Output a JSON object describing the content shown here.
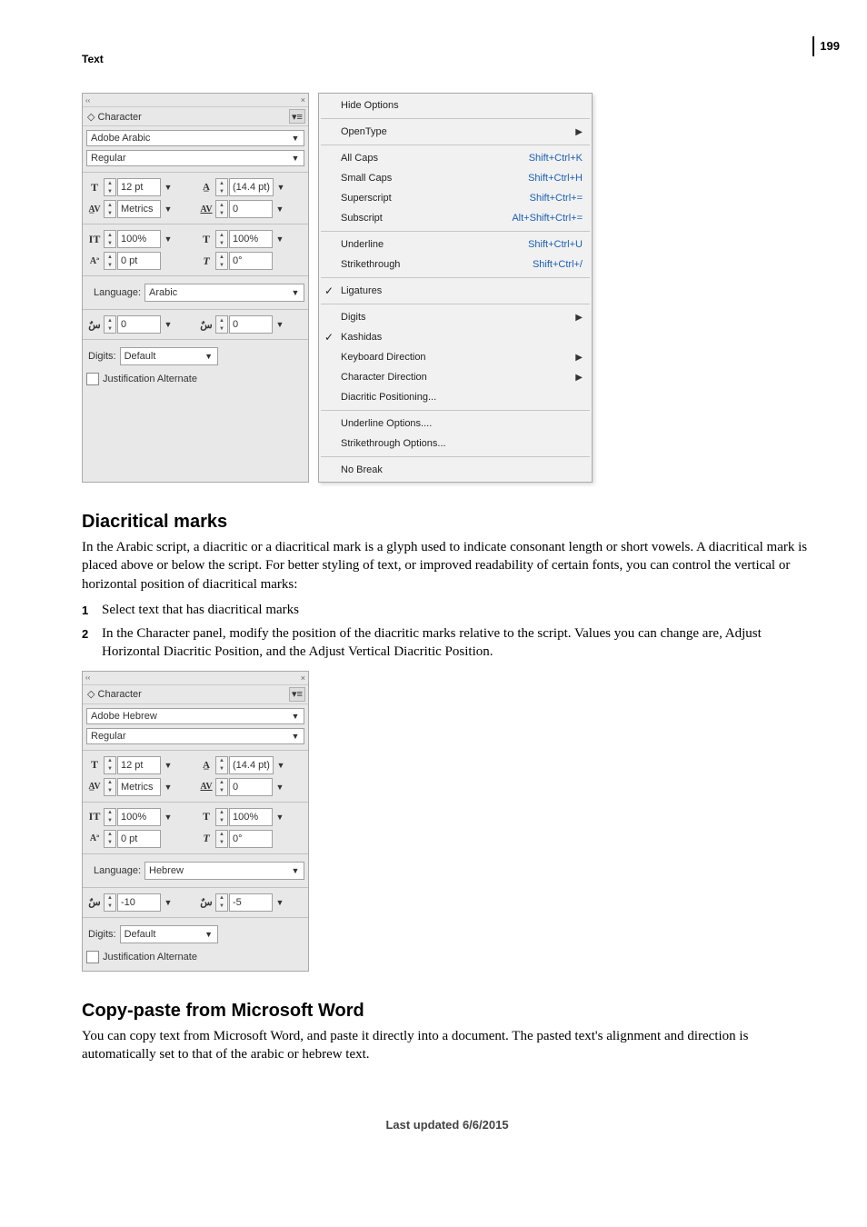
{
  "page_number": "199",
  "section_label": "Text",
  "footer": "Last updated 6/6/2015",
  "panel1": {
    "title": "Character",
    "font": "Adobe Arabic",
    "style": "Regular",
    "size": "12 pt",
    "leading": "(14.4 pt)",
    "kerning": "Metrics",
    "tracking": "0",
    "vscale": "100%",
    "hscale": "100%",
    "baseline": "0 pt",
    "skew": "0°",
    "language_label": "Language:",
    "language": "Arabic",
    "hdiac": "0",
    "vdiac": "0",
    "digits_label": "Digits:",
    "digits": "Default",
    "just_alt": "Justification Alternate"
  },
  "menu": {
    "hide_options": "Hide Options",
    "opentype": "OpenType",
    "all_caps": "All Caps",
    "all_caps_sc": "Shift+Ctrl+K",
    "small_caps": "Small Caps",
    "small_caps_sc": "Shift+Ctrl+H",
    "superscript": "Superscript",
    "superscript_sc": "Shift+Ctrl+=",
    "subscript": "Subscript",
    "subscript_sc": "Alt+Shift+Ctrl+=",
    "underline": "Underline",
    "underline_sc": "Shift+Ctrl+U",
    "strikethrough": "Strikethrough",
    "strikethrough_sc": "Shift+Ctrl+/",
    "ligatures": "Ligatures",
    "digits": "Digits",
    "kashidas": "Kashidas",
    "keyboard_direction": "Keyboard Direction",
    "character_direction": "Character Direction",
    "diacritic_positioning": "Diacritic Positioning...",
    "underline_options": "Underline Options....",
    "strikethrough_options": "Strikethrough Options...",
    "no_break": "No Break"
  },
  "h_diacritical": "Diacritical marks",
  "p_diacritical": "In the Arabic script, a diacritic or a diacritical mark is a glyph used to indicate consonant length or short vowels. A diacritical mark is placed above or below the script. For better styling of text, or improved readability of certain fonts, you can control the vertical or horizontal position of diacritical marks:",
  "step1": "Select text that has diacritical marks",
  "step2": "In the Character panel, modify the position of the diacritic marks relative to the script. Values you can change are, Adjust Horizontal Diacritic Position, and the Adjust Vertical Diacritic Position.",
  "panel2": {
    "title": "Character",
    "font": "Adobe Hebrew",
    "style": "Regular",
    "size": "12 pt",
    "leading": "(14.4 pt)",
    "kerning": "Metrics",
    "tracking": "0",
    "vscale": "100%",
    "hscale": "100%",
    "baseline": "0 pt",
    "skew": "0°",
    "language_label": "Language:",
    "language": "Hebrew",
    "hdiac": "-10",
    "vdiac": "-5",
    "digits_label": "Digits:",
    "digits": "Default",
    "just_alt": "Justification Alternate"
  },
  "h_copy": "Copy-paste from Microsoft Word",
  "p_copy": "You can copy text from Microsoft Word, and paste it directly into a document. The pasted text's alignment and direction is automatically set to that of the arabic or hebrew text."
}
